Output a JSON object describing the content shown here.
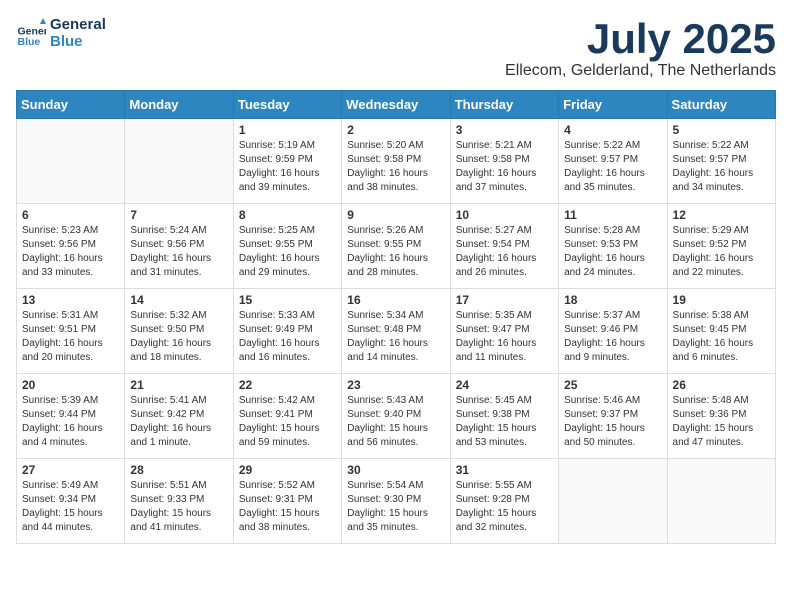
{
  "logo": {
    "line1": "General",
    "line2": "Blue"
  },
  "title": "July 2025",
  "location": "Ellecom, Gelderland, The Netherlands",
  "days_header": [
    "Sunday",
    "Monday",
    "Tuesday",
    "Wednesday",
    "Thursday",
    "Friday",
    "Saturday"
  ],
  "weeks": [
    [
      {
        "day": "",
        "sunrise": "",
        "sunset": "",
        "daylight": ""
      },
      {
        "day": "",
        "sunrise": "",
        "sunset": "",
        "daylight": ""
      },
      {
        "day": "1",
        "sunrise": "Sunrise: 5:19 AM",
        "sunset": "Sunset: 9:59 PM",
        "daylight": "Daylight: 16 hours and 39 minutes."
      },
      {
        "day": "2",
        "sunrise": "Sunrise: 5:20 AM",
        "sunset": "Sunset: 9:58 PM",
        "daylight": "Daylight: 16 hours and 38 minutes."
      },
      {
        "day": "3",
        "sunrise": "Sunrise: 5:21 AM",
        "sunset": "Sunset: 9:58 PM",
        "daylight": "Daylight: 16 hours and 37 minutes."
      },
      {
        "day": "4",
        "sunrise": "Sunrise: 5:22 AM",
        "sunset": "Sunset: 9:57 PM",
        "daylight": "Daylight: 16 hours and 35 minutes."
      },
      {
        "day": "5",
        "sunrise": "Sunrise: 5:22 AM",
        "sunset": "Sunset: 9:57 PM",
        "daylight": "Daylight: 16 hours and 34 minutes."
      }
    ],
    [
      {
        "day": "6",
        "sunrise": "Sunrise: 5:23 AM",
        "sunset": "Sunset: 9:56 PM",
        "daylight": "Daylight: 16 hours and 33 minutes."
      },
      {
        "day": "7",
        "sunrise": "Sunrise: 5:24 AM",
        "sunset": "Sunset: 9:56 PM",
        "daylight": "Daylight: 16 hours and 31 minutes."
      },
      {
        "day": "8",
        "sunrise": "Sunrise: 5:25 AM",
        "sunset": "Sunset: 9:55 PM",
        "daylight": "Daylight: 16 hours and 29 minutes."
      },
      {
        "day": "9",
        "sunrise": "Sunrise: 5:26 AM",
        "sunset": "Sunset: 9:55 PM",
        "daylight": "Daylight: 16 hours and 28 minutes."
      },
      {
        "day": "10",
        "sunrise": "Sunrise: 5:27 AM",
        "sunset": "Sunset: 9:54 PM",
        "daylight": "Daylight: 16 hours and 26 minutes."
      },
      {
        "day": "11",
        "sunrise": "Sunrise: 5:28 AM",
        "sunset": "Sunset: 9:53 PM",
        "daylight": "Daylight: 16 hours and 24 minutes."
      },
      {
        "day": "12",
        "sunrise": "Sunrise: 5:29 AM",
        "sunset": "Sunset: 9:52 PM",
        "daylight": "Daylight: 16 hours and 22 minutes."
      }
    ],
    [
      {
        "day": "13",
        "sunrise": "Sunrise: 5:31 AM",
        "sunset": "Sunset: 9:51 PM",
        "daylight": "Daylight: 16 hours and 20 minutes."
      },
      {
        "day": "14",
        "sunrise": "Sunrise: 5:32 AM",
        "sunset": "Sunset: 9:50 PM",
        "daylight": "Daylight: 16 hours and 18 minutes."
      },
      {
        "day": "15",
        "sunrise": "Sunrise: 5:33 AM",
        "sunset": "Sunset: 9:49 PM",
        "daylight": "Daylight: 16 hours and 16 minutes."
      },
      {
        "day": "16",
        "sunrise": "Sunrise: 5:34 AM",
        "sunset": "Sunset: 9:48 PM",
        "daylight": "Daylight: 16 hours and 14 minutes."
      },
      {
        "day": "17",
        "sunrise": "Sunrise: 5:35 AM",
        "sunset": "Sunset: 9:47 PM",
        "daylight": "Daylight: 16 hours and 11 minutes."
      },
      {
        "day": "18",
        "sunrise": "Sunrise: 5:37 AM",
        "sunset": "Sunset: 9:46 PM",
        "daylight": "Daylight: 16 hours and 9 minutes."
      },
      {
        "day": "19",
        "sunrise": "Sunrise: 5:38 AM",
        "sunset": "Sunset: 9:45 PM",
        "daylight": "Daylight: 16 hours and 6 minutes."
      }
    ],
    [
      {
        "day": "20",
        "sunrise": "Sunrise: 5:39 AM",
        "sunset": "Sunset: 9:44 PM",
        "daylight": "Daylight: 16 hours and 4 minutes."
      },
      {
        "day": "21",
        "sunrise": "Sunrise: 5:41 AM",
        "sunset": "Sunset: 9:42 PM",
        "daylight": "Daylight: 16 hours and 1 minute."
      },
      {
        "day": "22",
        "sunrise": "Sunrise: 5:42 AM",
        "sunset": "Sunset: 9:41 PM",
        "daylight": "Daylight: 15 hours and 59 minutes."
      },
      {
        "day": "23",
        "sunrise": "Sunrise: 5:43 AM",
        "sunset": "Sunset: 9:40 PM",
        "daylight": "Daylight: 15 hours and 56 minutes."
      },
      {
        "day": "24",
        "sunrise": "Sunrise: 5:45 AM",
        "sunset": "Sunset: 9:38 PM",
        "daylight": "Daylight: 15 hours and 53 minutes."
      },
      {
        "day": "25",
        "sunrise": "Sunrise: 5:46 AM",
        "sunset": "Sunset: 9:37 PM",
        "daylight": "Daylight: 15 hours and 50 minutes."
      },
      {
        "day": "26",
        "sunrise": "Sunrise: 5:48 AM",
        "sunset": "Sunset: 9:36 PM",
        "daylight": "Daylight: 15 hours and 47 minutes."
      }
    ],
    [
      {
        "day": "27",
        "sunrise": "Sunrise: 5:49 AM",
        "sunset": "Sunset: 9:34 PM",
        "daylight": "Daylight: 15 hours and 44 minutes."
      },
      {
        "day": "28",
        "sunrise": "Sunrise: 5:51 AM",
        "sunset": "Sunset: 9:33 PM",
        "daylight": "Daylight: 15 hours and 41 minutes."
      },
      {
        "day": "29",
        "sunrise": "Sunrise: 5:52 AM",
        "sunset": "Sunset: 9:31 PM",
        "daylight": "Daylight: 15 hours and 38 minutes."
      },
      {
        "day": "30",
        "sunrise": "Sunrise: 5:54 AM",
        "sunset": "Sunset: 9:30 PM",
        "daylight": "Daylight: 15 hours and 35 minutes."
      },
      {
        "day": "31",
        "sunrise": "Sunrise: 5:55 AM",
        "sunset": "Sunset: 9:28 PM",
        "daylight": "Daylight: 15 hours and 32 minutes."
      },
      {
        "day": "",
        "sunrise": "",
        "sunset": "",
        "daylight": ""
      },
      {
        "day": "",
        "sunrise": "",
        "sunset": "",
        "daylight": ""
      }
    ]
  ]
}
